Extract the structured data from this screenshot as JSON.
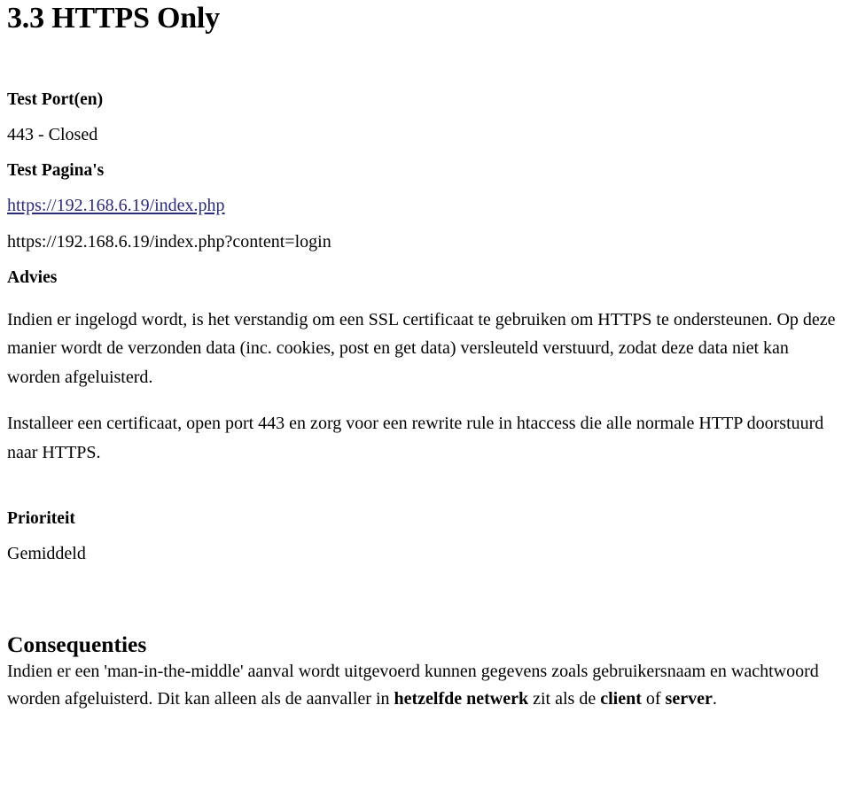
{
  "document": {
    "title": "3.3 HTTPS Only",
    "sections": {
      "test_ports": {
        "heading": "Test Port(en)",
        "value": "443 - Closed"
      },
      "test_pages": {
        "heading": "Test Pagina's",
        "link_url_text": "https://192.168.6.19/index.php",
        "plain_url_text": "https://192.168.6.19/index.php?content=login"
      },
      "advies": {
        "heading": "Advies",
        "paragraph_1": "Indien er ingelogd wordt, is het verstandig om een SSL certificaat te gebruiken om HTTPS te ondersteunen. Op deze manier wordt de verzonden data (inc. cookies, post en get data) versleuteld verstuurd, zodat deze data niet kan worden afgeluisterd.",
        "paragraph_2": "Installeer een certificaat, open port 443 en zorg voor een rewrite rule in htaccess die alle normale HTTP doorstuurd naar HTTPS."
      },
      "prioriteit": {
        "heading": "Prioriteit",
        "value": "Gemiddeld"
      },
      "consequenties": {
        "heading": "Consequenties",
        "text_part_1": "Indien er een 'man-in-the-middle' aanval wordt uitgevoerd kunnen gegevens zoals gebruikersnaam en wachtwoord worden afgeluisterd. Dit kan alleen als de aanvaller in ",
        "bold_1": "hetzelfde netwerk",
        "text_part_2": " zit als de ",
        "bold_2": "client",
        "text_part_3": " of ",
        "bold_3": "server",
        "text_part_4": "."
      }
    },
    "colors": {
      "link": "#2a2a7a",
      "text": "#000000",
      "background": "#ffffff"
    }
  }
}
